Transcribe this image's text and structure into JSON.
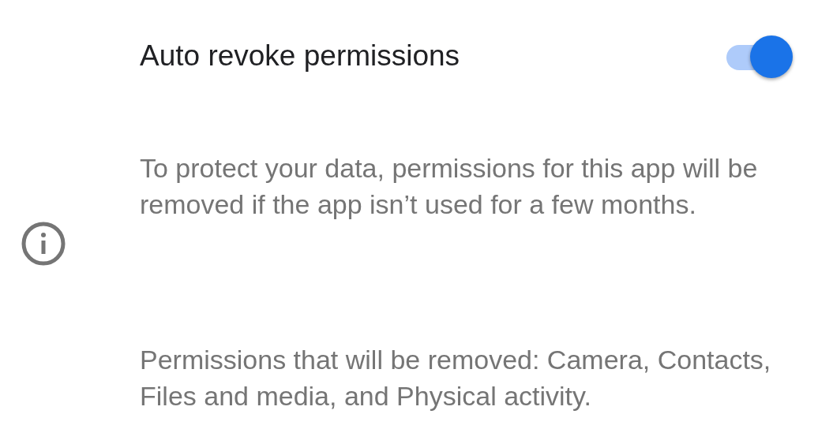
{
  "title": "Auto revoke permissions",
  "toggle": {
    "on": true
  },
  "description": "To protect your data, permissions for this app will be removed if the app isn’t used for a few months.",
  "removed_permissions": "Permissions that will be removed: Camera, Contacts, Files and media, and Physical activity."
}
